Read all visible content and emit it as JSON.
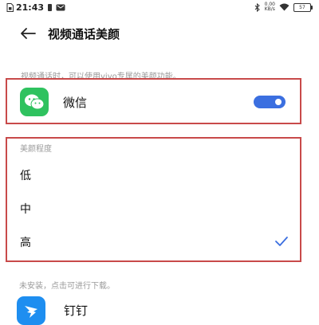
{
  "status_bar": {
    "time": "21:43",
    "net_speed_value": "0.00",
    "net_speed_unit": "KB/s",
    "battery": "57"
  },
  "header": {
    "title": "视频通话美颜"
  },
  "hint_text": "视频通话时，可以使用vivo专属的美颜功能。",
  "wechat": {
    "label": "微信",
    "enabled": true
  },
  "beauty_level": {
    "label": "美颜程度",
    "options": [
      "低",
      "中",
      "高"
    ],
    "selected": "高"
  },
  "not_installed_text": "未安装，点击可进行下载。",
  "dingtalk": {
    "label": "钉钉"
  },
  "colors": {
    "accent": "#3b6fe0",
    "wechat_green": "#2fc25f",
    "dingtalk_blue": "#1e8ef0",
    "annotation_red": "#c84a4a"
  }
}
